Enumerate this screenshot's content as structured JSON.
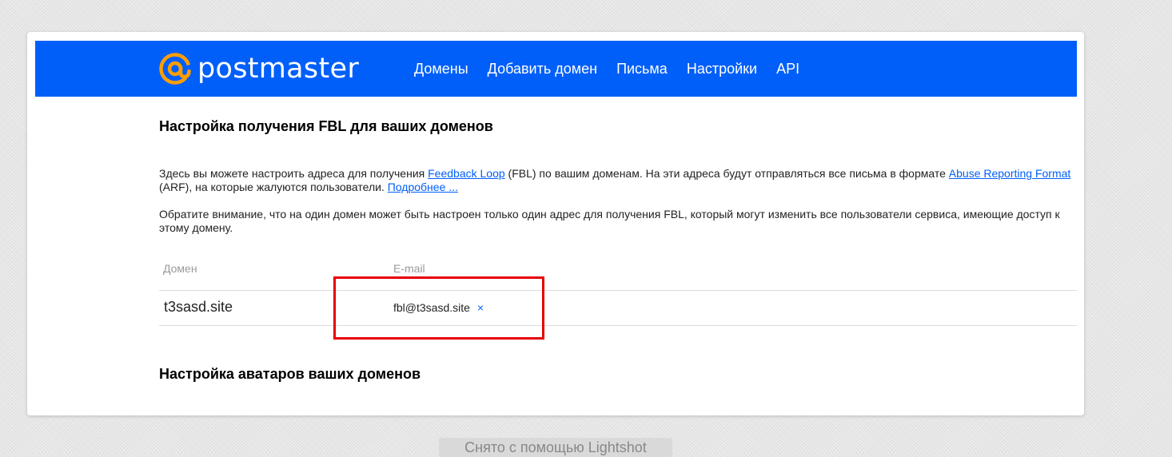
{
  "header": {
    "brand": "postmaster",
    "nav": [
      "Домены",
      "Добавить домен",
      "Письма",
      "Настройки",
      "API"
    ]
  },
  "fbl": {
    "title": "Настройка получения FBL для ваших доменов",
    "intro": {
      "text1": "Здесь вы можете настроить адреса для получения ",
      "link1": "Feedback Loop",
      "text2": " (FBL) по вашим доменам. На эти адреса будут отправляться все письма в формате ",
      "link2": "Abuse Reporting Format",
      "text3": " (ARF), на которые жалуются пользователи. ",
      "link3": "Подробнее ..."
    },
    "note": "Обратите внимание, что на один домен может быть настроен только один адрес для получения FBL, который могут изменить все пользователи сервиса, имеющие доступ к этому домену.",
    "table": {
      "headers": {
        "domain": "Домен",
        "email": "E-mail"
      },
      "rows": [
        {
          "domain": "t3sasd.site",
          "email": "fbl@t3sasd.site",
          "remove": "×"
        }
      ]
    }
  },
  "avatars": {
    "title": "Настройка аватаров ваших доменов"
  },
  "watermark": "Снято с помощью Lightshot",
  "colors": {
    "brand_blue": "#005ff9",
    "logo_orange": "#ff9e00",
    "highlight_red": "#e60000"
  }
}
